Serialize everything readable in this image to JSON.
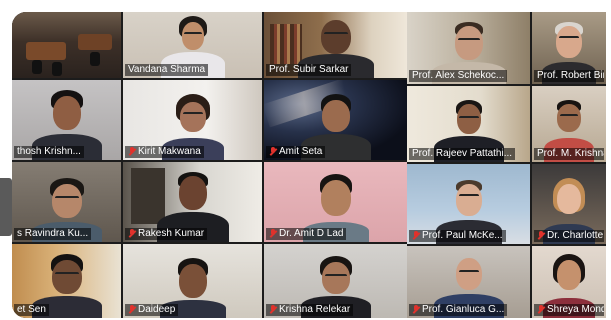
{
  "meeting": {
    "left_gallery": {
      "tiles": [
        {
          "name": "",
          "muted": false
        },
        {
          "name": "Vandana Sharma",
          "muted": false
        },
        {
          "name": "Prof. Subir Sarkar",
          "muted": false,
          "active_speaker": true
        },
        {
          "name": "thosh Krishn...",
          "muted": false
        },
        {
          "name": "Kirit Makwana",
          "muted": true
        },
        {
          "name": "Amit Seta",
          "muted": true
        },
        {
          "name": "s Ravindra Ku...",
          "muted": false
        },
        {
          "name": "Rakesh Kumar",
          "muted": true
        },
        {
          "name": "Dr. Amit D Lad",
          "muted": true
        },
        {
          "name": "et Sen",
          "muted": false
        },
        {
          "name": "Daideep",
          "muted": true
        },
        {
          "name": "Krishna Relekar",
          "muted": true
        }
      ]
    },
    "right_gallery": {
      "tiles": [
        {
          "name": "Prof. Alex Schekoc...",
          "muted": false
        },
        {
          "name": "Prof. Robert Bingha...",
          "muted": false
        },
        {
          "name": "Prof. Rajeev Pattathi...",
          "muted": false
        },
        {
          "name": "Prof. M. Krishnamu...",
          "muted": false
        },
        {
          "name": "Prof. Paul McKe...",
          "muted": true
        },
        {
          "name": "Dr. Charlotte Pa...",
          "muted": true
        },
        {
          "name": "Prof. Gianluca G...",
          "muted": true
        },
        {
          "name": "Shreya Mondal",
          "muted": true
        }
      ]
    },
    "colors": {
      "background": "#1c1c1c",
      "active_speaker_border": "#b6ec3d",
      "muted_icon": "#e0322c",
      "name_label_text": "#ffffff"
    }
  }
}
